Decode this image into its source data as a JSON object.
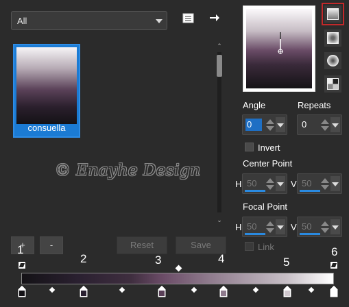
{
  "library": {
    "category_value": "All",
    "icons": [
      "gradient-list-icon",
      "arrow-right-icon"
    ]
  },
  "gallery": {
    "items": [
      {
        "name": "consuella"
      }
    ]
  },
  "watermark": "© Enayhe Design",
  "buttons": {
    "add": "+",
    "remove": "-",
    "reset": "Reset",
    "save": "Save"
  },
  "settings": {
    "angle_label": "Angle",
    "angle_value": "0",
    "repeats_label": "Repeats",
    "repeats_value": "0",
    "invert_label": "Invert",
    "center_point_label": "Center Point",
    "center_h_label": "H",
    "center_h_value": "50",
    "center_v_label": "V",
    "center_v_value": "50",
    "focal_point_label": "Focal Point",
    "focal_h_label": "H",
    "focal_h_value": "50",
    "focal_v_label": "V",
    "focal_v_value": "50",
    "link_label": "Link"
  },
  "stops": {
    "labels": [
      "1",
      "2",
      "3",
      "4",
      "5",
      "6"
    ]
  },
  "colors": {
    "accent": "#1e6fc4",
    "selection_outline": "#c2292a",
    "gradient": [
      "#141216",
      "#3f2e3f",
      "#6a4b66",
      "#c7bfc6",
      "#ffffff"
    ]
  }
}
